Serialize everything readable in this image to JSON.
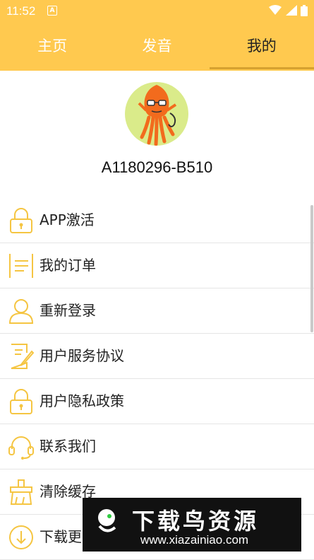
{
  "status": {
    "time": "11:52",
    "notif_icon": "A"
  },
  "tabs": [
    {
      "label": "主页"
    },
    {
      "label": "发音"
    },
    {
      "label": "我的"
    }
  ],
  "profile": {
    "user_id": "A1180296-B510"
  },
  "menu": [
    {
      "label": "APP激活",
      "icon": "lock-icon"
    },
    {
      "label": "我的订单",
      "icon": "list-icon"
    },
    {
      "label": "重新登录",
      "icon": "user-icon"
    },
    {
      "label": "用户服务协议",
      "icon": "document-edit-icon"
    },
    {
      "label": "用户隐私政策",
      "icon": "lock-icon"
    },
    {
      "label": "联系我们",
      "icon": "headset-icon"
    },
    {
      "label": "清除缓存",
      "icon": "clear-icon"
    },
    {
      "label": "下载更",
      "icon": "download-icon"
    }
  ],
  "watermark": {
    "title": "下载鸟资源",
    "url": "www.xiazainiao.com"
  },
  "colors": {
    "header": "#FFC94F",
    "icon": "#F5C542",
    "tab_indicator": "#D6A12F"
  }
}
